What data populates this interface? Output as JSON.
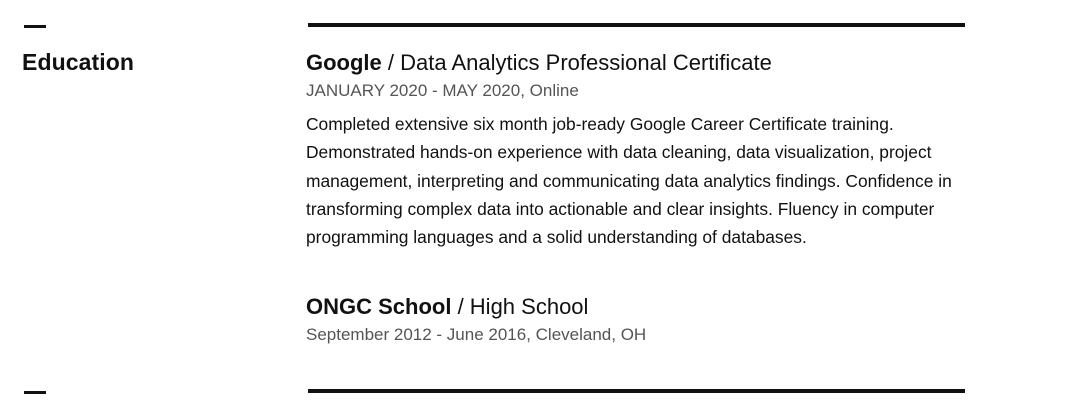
{
  "section": {
    "title": "Education"
  },
  "entries": [
    {
      "organization": "Google",
      "separator": " / ",
      "program": "Data Analytics Professional Certificate",
      "meta": "JANUARY  2020 - MAY 2020,  Online",
      "description_lines": [
        "Completed extensive six month job-ready Google Career Certificate training.",
        "Demonstrated hands-on experience with data cleaning,  data visualization, project",
        "management,  interpreting and communicating data analytics findings.  Confidence in",
        "transforming complex data into actionable and clear insights. Fluency in computer",
        "programming languages and a solid understanding of databases."
      ]
    },
    {
      "organization": "ONGC  School",
      "separator": " / ",
      "program": "High School",
      "meta": "September 2012 - June 2016,  Cleveland, OH"
    }
  ],
  "colors": {
    "text": "#111111",
    "meta_text": "#555555",
    "rule": "#111111",
    "background": "#ffffff"
  }
}
